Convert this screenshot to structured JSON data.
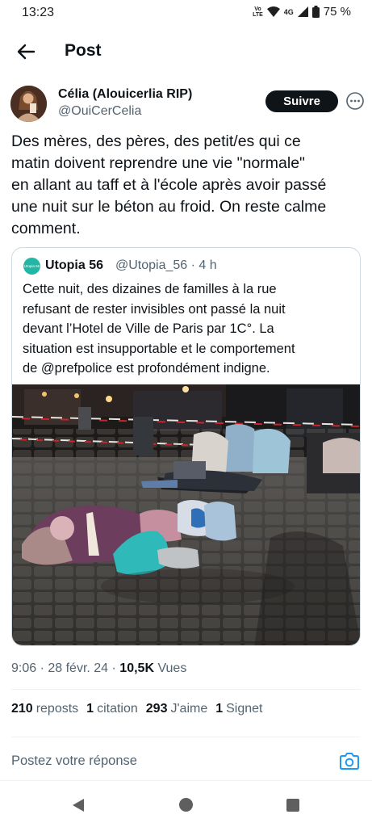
{
  "status_bar": {
    "time": "13:23",
    "lte_top": "Vo",
    "lte_bottom": "LTE",
    "network": "4G",
    "battery": "75 %"
  },
  "header": {
    "title": "Post",
    "back_icon": "arrow-left-icon"
  },
  "author": {
    "name": "Célia (Alouicerlia RIP)",
    "handle": "@OuiCerCelia",
    "follow_label": "Suivre"
  },
  "tweet": {
    "lines": [
      "Des mères, des pères, des petit/es qui ce",
      "matin doivent reprendre une vie \"normale\"",
      "en allant au taff et à l'école après avoir passé",
      "une nuit sur le béton au froid. On reste calme",
      "comment."
    ]
  },
  "quote": {
    "avatar_text": "Utopia 56",
    "name": "Utopia 56",
    "meta": "@Utopia_56 · 4 h",
    "lines": [
      "Cette nuit, des dizaines de familles à la rue",
      "refusant de rester invisibles ont passé la nuit",
      "devant l’Hotel de Ville de Paris par 1C°. La",
      "situation est insupportable et le comportement",
      "de @prefpolice est profondément indigne."
    ]
  },
  "meta": {
    "time_date": "9:06 · 28 févr. 24 · ",
    "views": "10,5K",
    "views_label": " Vues"
  },
  "stats": [
    {
      "count": "210",
      "label": "reposts"
    },
    {
      "count": "1",
      "label": "citation"
    },
    {
      "count": "293",
      "label": "J'aime"
    },
    {
      "count": "1",
      "label": "Signet"
    }
  ],
  "reply": {
    "placeholder": "Postez votre réponse"
  },
  "colors": {
    "text": "#0f1419",
    "secondary": "#536471",
    "accent": "#1d9bf0",
    "border": "#cfd9de"
  }
}
